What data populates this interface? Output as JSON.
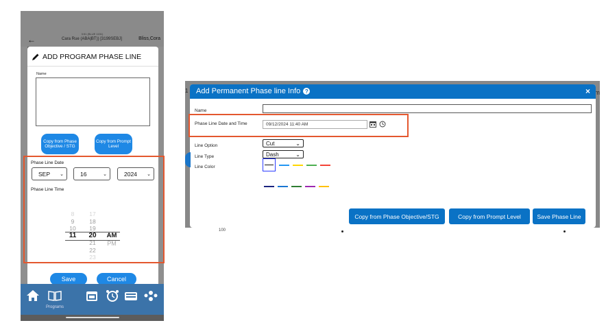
{
  "mobile": {
    "header": {
      "back_glyph": "←",
      "line1": "3:51 (BLUE 1151)",
      "line2": "Cara Rue (ABA|BT)) [3199SEBJ]",
      "client": "Bliss,Cora"
    },
    "dialog": {
      "title": "ADD PROGRAM PHASE LINE",
      "name_label": "Name",
      "name_value": "",
      "copy_phase_label": "Copy from Phase Objective / STG",
      "copy_prompt_label": "Copy from Prompt Level",
      "phase_line_date_label": "Phase Line Date",
      "month": "SEP",
      "day": "16",
      "year": "2024",
      "phase_line_time_label": "Phase Line Time",
      "hour_wheel": [
        "8",
        "9",
        "10",
        "11"
      ],
      "minute_wheel": [
        "17",
        "18",
        "19",
        "20",
        "21",
        "22",
        "23"
      ],
      "ampm_wheel": [
        "AM",
        "PM"
      ],
      "save_label": "Save",
      "cancel_label": "Cancel"
    },
    "bottom_nav": {
      "items": [
        "home-icon",
        "programs-icon",
        "calendar-icon",
        "alarm-icon",
        "keyboard-icon",
        "team-icon"
      ],
      "programs_label": "Programs"
    }
  },
  "desktop": {
    "left_hint": "1",
    "right_hint": "m",
    "modal": {
      "title": "Add Permanent Phase line Info",
      "close_glyph": "×",
      "name_label": "Name",
      "name_value": "",
      "date_time_label": "Phase Line Date and Time",
      "date_time_value": "09/12/2024 11:40 AM",
      "line_option_label": "Line Option",
      "line_option_value": "Cut",
      "line_type_label": "Line Type",
      "line_type_value": "Dash",
      "line_color_label": "Line Color",
      "line_colors_row1": [
        "#111111",
        "#2196f3",
        "#ffd600",
        "#4caf50",
        "#f44336"
      ],
      "line_colors_row2": [
        "#1a237e",
        "#1976d2",
        "#2e7d32",
        "#9c27b0",
        "#ffc107"
      ],
      "selected_color": "#111111",
      "copy_phase_button": "Copy from Phase Objective/STG",
      "copy_prompt_button": "Copy from Prompt Level",
      "save_button": "Save Phase Line"
    },
    "below_value": "100"
  },
  "highlight_color": "#e4572e",
  "accent_color": "#0a72c5"
}
